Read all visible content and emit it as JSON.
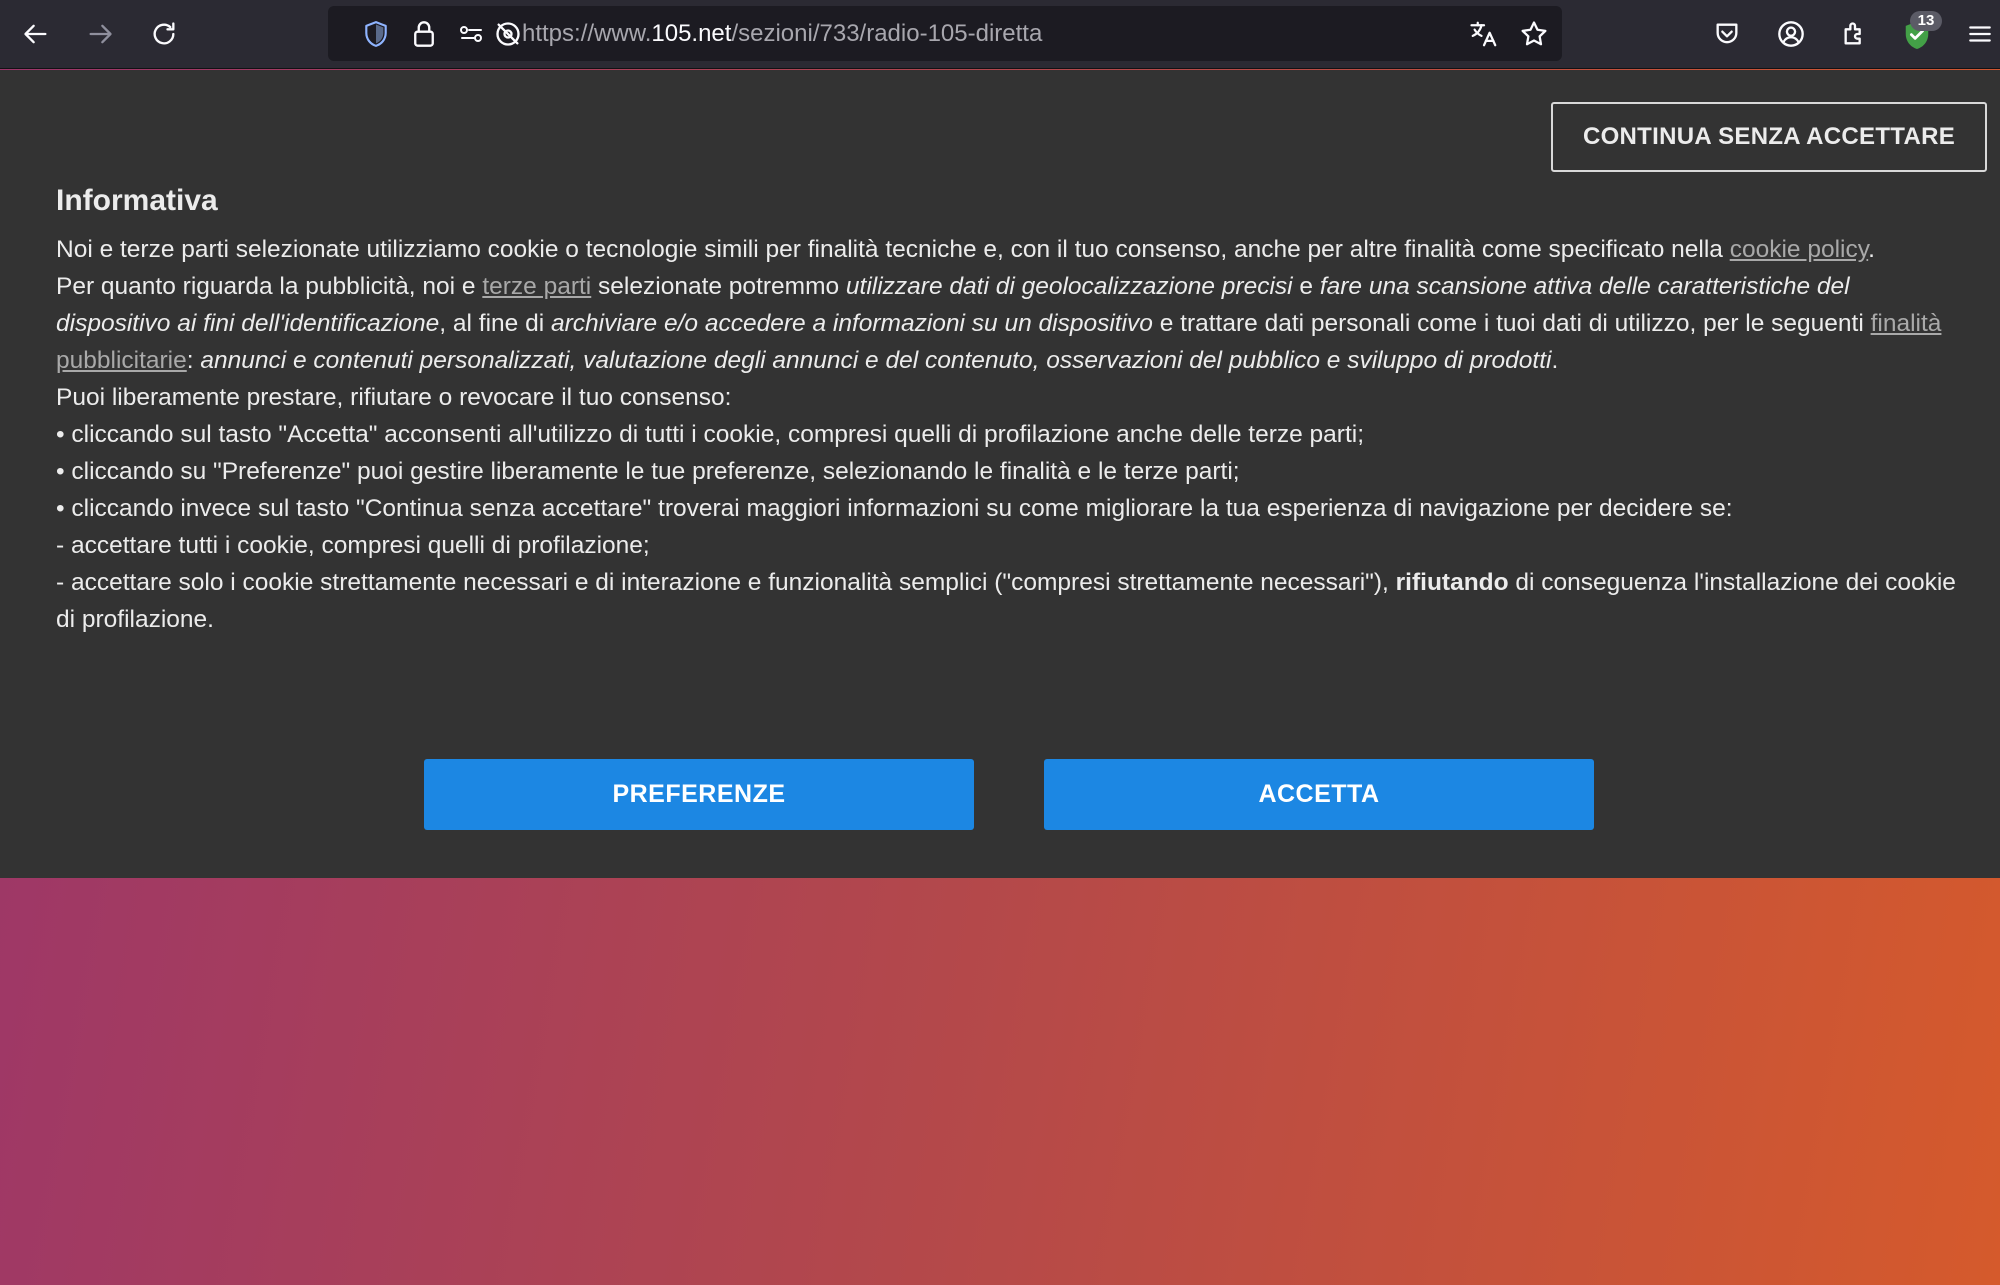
{
  "browser": {
    "url_prefix": "https://www.",
    "url_host": "105.net",
    "url_path": "/sezioni/733/radio-105-diretta",
    "extension_badge": "13",
    "accent_shield_color": "#43a047"
  },
  "banner": {
    "skip_label": "CONTINUA SENZA ACCETTARE",
    "title": "Informativa",
    "p1": {
      "text": "Noi e terze parti selezionate utilizziamo cookie o tecnologie simili per finalità tecniche e, con il tuo consenso, anche per altre finalità come specificato nella ",
      "link": "cookie policy",
      "end": "."
    },
    "p2": {
      "t1": "Per quanto riguarda la pubblicità, noi e ",
      "link1": "terze parti",
      "t2": " selezionate potremmo ",
      "i1": "utilizzare dati di geolocalizzazione precisi",
      "t3": " e ",
      "i2": "fare una scansione attiva delle caratteristiche del dispositivo ai fini dell'identificazione",
      "t4": ", al fine di ",
      "i3": "archiviare e/o accedere a informazioni su un dispositivo",
      "t5": " e trattare dati personali come i tuoi dati di utilizzo, per le seguenti ",
      "link2": "finalità pubblicitarie",
      "t6": ": ",
      "i4": "annunci e contenuti personalizzati, valutazione degli annunci e del contenuto, osservazioni del pubblico e sviluppo di prodotti",
      "end": "."
    },
    "p3": "Puoi liberamente prestare, rifiutare o revocare il tuo consenso:",
    "bullet1": "• cliccando sul tasto \"Accetta\" acconsenti all'utilizzo di tutti i cookie, compresi quelli di profilazione anche delle terze parti;",
    "bullet2": "• cliccando su \"Preferenze\" puoi gestire liberamente le tue preferenze, selezionando le finalità e le terze parti;",
    "bullet3": "• cliccando invece sul tasto \"Continua senza accettare\" troverai maggiori informazioni su come migliorare la tua esperienza di navigazione per decidere se:",
    "sub1": "  - accettare tutti i cookie, compresi quelli di profilazione;",
    "sub2": {
      "t1": "  - accettare solo i cookie strettamente necessari e di interazione e funzionalità semplici (\"compresi strettamente necessari\"), ",
      "bold": "rifiutando",
      "t2": " di conseguenza l'installazione dei cookie di profilazione."
    },
    "preferences_label": "PREFERENZE",
    "accept_label": "ACCETTA",
    "button_color": "#1c87e3"
  }
}
